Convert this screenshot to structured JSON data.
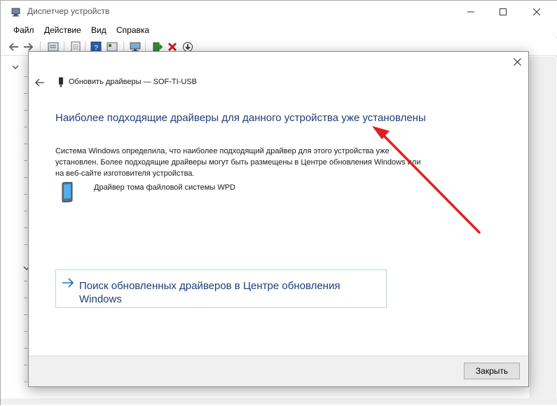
{
  "window": {
    "title": "Диспетчер устройств"
  },
  "menu": [
    "Файл",
    "Действие",
    "Вид",
    "Справка"
  ],
  "dialog": {
    "title": "Обновить драйверы — SOF-TI-USB",
    "heading": "Наиболее подходящие драйверы для данного устройства уже установлены",
    "body": "Система Windows определила, что наиболее подходящий драйвер для этого устройства уже установлен. Более подходящие драйверы могут быть размещены в Центре обновления Windows или на веб-сайте изготовителя устройства.",
    "driver_name": "Драйвер тома файловой системы WPD",
    "search_link": "Поиск обновленных драйверов в Центре обновления Windows",
    "close_label": "Закрыть"
  },
  "icons": {
    "app": "device-manager-icon",
    "back": "back-arrow-icon",
    "forward": "forward-arrow-icon",
    "close": "close-icon",
    "driver": "portable-device-icon",
    "search_arrow": "right-arrow-icon"
  },
  "colors": {
    "link_blue": "#1f3d7a",
    "annotation_red": "#e02020",
    "link_border": "#bcd5e6"
  }
}
